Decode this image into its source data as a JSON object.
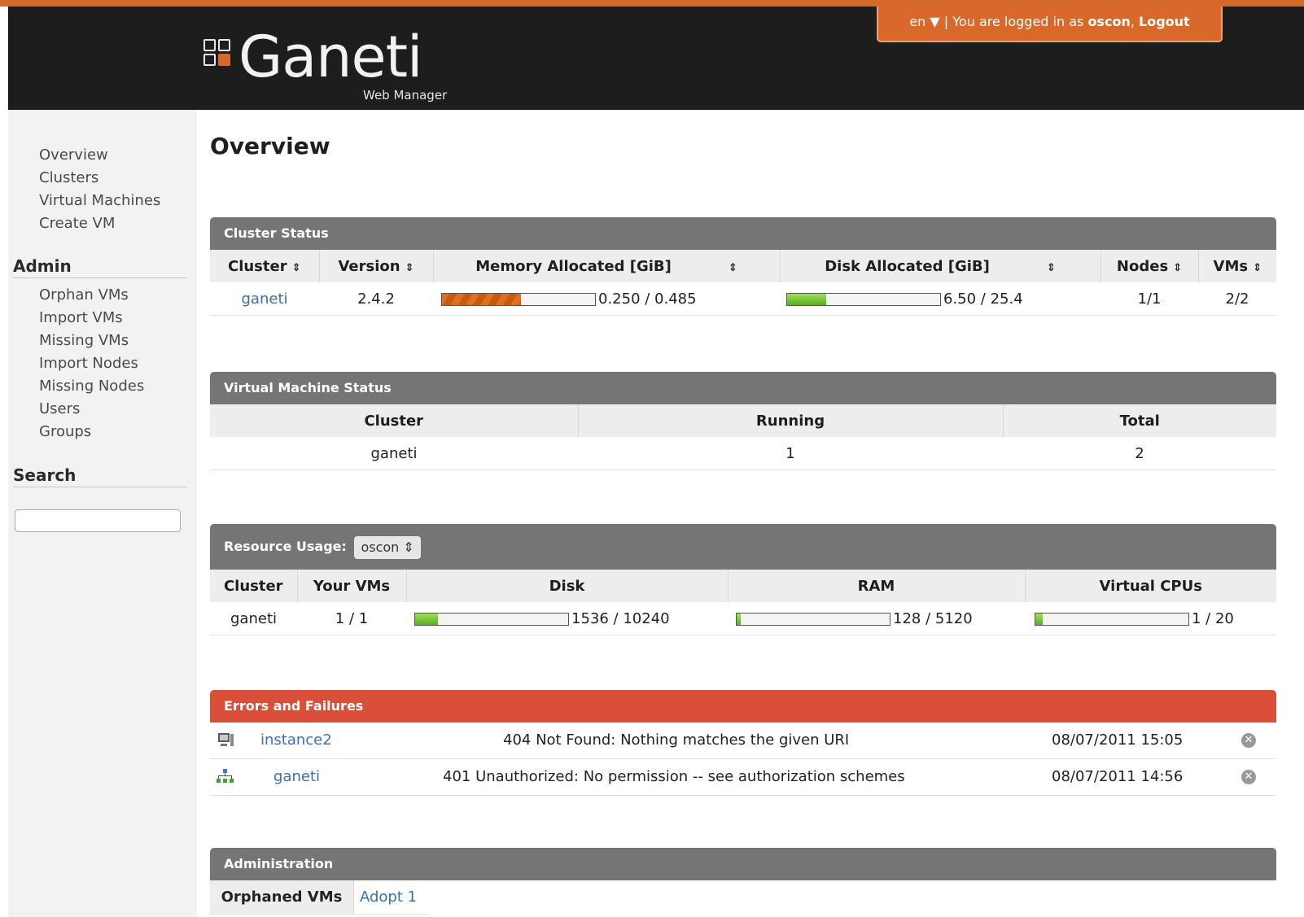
{
  "header": {
    "logo_text": "Ganeti",
    "logo_sub": "Web Manager",
    "lang": "en ▼",
    "login_prefix": "| You are logged in as",
    "username": "oscon",
    "logout": "Logout"
  },
  "sidebar": {
    "nav": [
      "Overview",
      "Clusters",
      "Virtual Machines",
      "Create VM"
    ],
    "admin_heading": "Admin",
    "admin": [
      "Orphan VMs",
      "Import VMs",
      "Missing VMs",
      "Import Nodes",
      "Missing Nodes",
      "Users",
      "Groups"
    ],
    "search_heading": "Search",
    "search_value": ""
  },
  "page_title": "Overview",
  "cluster_status": {
    "title": "Cluster Status",
    "headers": [
      "Cluster",
      "Version",
      "Memory Allocated [GiB]",
      "Disk Allocated [GiB]",
      "Nodes",
      "VMs"
    ],
    "sort_icon": "⇕",
    "row": {
      "cluster": "ganeti",
      "version": "2.4.2",
      "memory_text": "0.250 / 0.485",
      "memory_fraction": 0.515,
      "disk_text": "6.50 / 25.4",
      "disk_fraction": 0.256,
      "nodes": "1/1",
      "vms": "2/2"
    }
  },
  "vm_status": {
    "title": "Virtual Machine Status",
    "headers": [
      "Cluster",
      "Running",
      "Total"
    ],
    "row": {
      "cluster": "ganeti",
      "running": "1",
      "total": "2"
    }
  },
  "resource_usage": {
    "title": "Resource Usage:",
    "selected_user": "oscon",
    "headers": [
      "Cluster",
      "Your VMs",
      "Disk",
      "RAM",
      "Virtual CPUs"
    ],
    "row": {
      "cluster": "ganeti",
      "your_vms": "1 / 1",
      "disk_text": "1536 / 10240",
      "disk_fraction": 0.15,
      "ram_text": "128 / 5120",
      "ram_fraction": 0.025,
      "cpu_text": "1 / 20",
      "cpu_fraction": 0.05
    }
  },
  "errors": {
    "title": "Errors and Failures",
    "items": [
      {
        "icon": "vm-icon",
        "name": "instance2",
        "message": "404 Not Found: Nothing matches the given URI",
        "time": "08/07/2011 15:05"
      },
      {
        "icon": "cluster-icon",
        "name": "ganeti",
        "message": "401 Unauthorized: No permission -- see authorization schemes",
        "time": "08/07/2011 14:56"
      }
    ],
    "close_glyph": "✕"
  },
  "administration": {
    "title": "Administration",
    "label": "Orphaned VMs",
    "link": "Adopt 1"
  },
  "colors": {
    "accent": "#d9692b",
    "header_bg": "#1d1d1d",
    "panel_head": "#757575",
    "error_head": "#d94f3a",
    "link": "#3a6fb3"
  }
}
